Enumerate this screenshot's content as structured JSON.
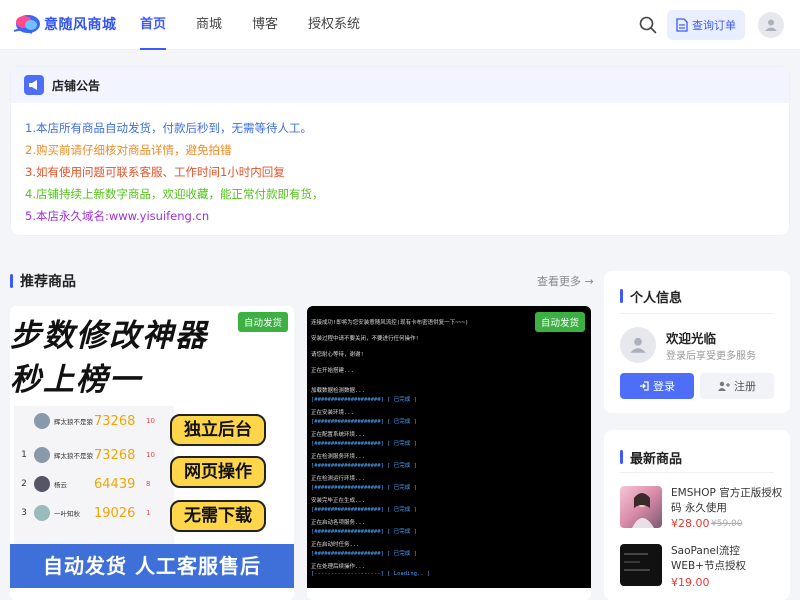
{
  "header": {
    "brand": "意随风商城",
    "nav": [
      {
        "label": "首页",
        "active": true
      },
      {
        "label": "商城",
        "active": false
      },
      {
        "label": "博客",
        "active": false
      },
      {
        "label": "授权系统",
        "active": false
      }
    ],
    "search_icon": "search-icon",
    "order_button": "查询订单",
    "accent_color": "#3d5afe"
  },
  "notice": {
    "title": "店铺公告",
    "lines": [
      {
        "text": "1.本店所有商品自动发货，付款后秒到，无需等待人工。",
        "color": "#3d6fe0"
      },
      {
        "text": "2.购买前请仔细核对商品详情，避免拍错",
        "color": "#f08a24"
      },
      {
        "text": "3.如有使用问题可联系客服、工作时间1小时内回复",
        "color": "#e0532b"
      },
      {
        "text": "4.店铺持续上新数字商品，欢迎收藏，能正常付款即有货，",
        "color": "#52c41a"
      },
      {
        "text": "5.本店永久域名:www.yisuifeng.cn",
        "color": "#9b30d9"
      }
    ]
  },
  "recommended": {
    "title": "推荐商品",
    "see_more": "查看更多 →",
    "products": [
      {
        "badge": "自动发货",
        "art": {
          "headline1": "步数修改神器",
          "headline2": "秒上榜一",
          "ranks": [
            {
              "num": "",
              "name": "辉太狼不是狼",
              "steps": "73268",
              "likes": "10"
            },
            {
              "num": "1",
              "name": "辉太狼不是狼",
              "steps": "73268",
              "likes": "10"
            },
            {
              "num": "2",
              "name": "杨云",
              "steps": "64439",
              "likes": "8"
            },
            {
              "num": "3",
              "name": "一叶知秋",
              "steps": "19026",
              "likes": "1"
            }
          ],
          "tags": [
            "独立后台",
            "网页操作",
            "无需下载"
          ],
          "footer": "自动发货 人工客服售后"
        }
      },
      {
        "badge": "自动发货",
        "art": {
          "lines": [
            "连接成功!即将为您安装意随风流控(现有卡布密语供复一下~~~)",
            "安装过程中请不要关闭，不要进行任何操作!",
            "请您耐心等待，谢谢!",
            "正在开始搭建...",
            "加载数据检测数据...",
            "[####################] [ 已完成 ]",
            "正在安装环境...",
            "[####################] [ 已完成 ]",
            "正在配置系统环境...",
            "[####################] [ 已完成 ]",
            "正在检测服务环境...",
            "[####################] [ 已完成 ]",
            "正在检测运行环境...",
            "[####################] [ 已完成 ]",
            "安装完毕正在生成...",
            "[####################] [ 已完成 ]",
            "正在启动各项服务...",
            "[####################] [ 已完成 ]",
            "正在启动时任务...",
            "[####################] [ 已完成 ]",
            "正在处理后续操作...",
            "[--------------------] [ Loading.. ]"
          ]
        }
      }
    ]
  },
  "profile": {
    "title": "个人信息",
    "welcome": "欢迎光临",
    "subtitle": "登录后享受更多服务",
    "login": "登录",
    "register": "注册"
  },
  "latest": {
    "title": "最新商品",
    "items": [
      {
        "name": "EMSHOP 官方正版授权码 永久使用",
        "price": "¥28.00",
        "old_price": "¥59.00"
      },
      {
        "name": "SaoPanel流控WEB+节点授权",
        "price": "¥19.00",
        "old_price": ""
      }
    ]
  }
}
